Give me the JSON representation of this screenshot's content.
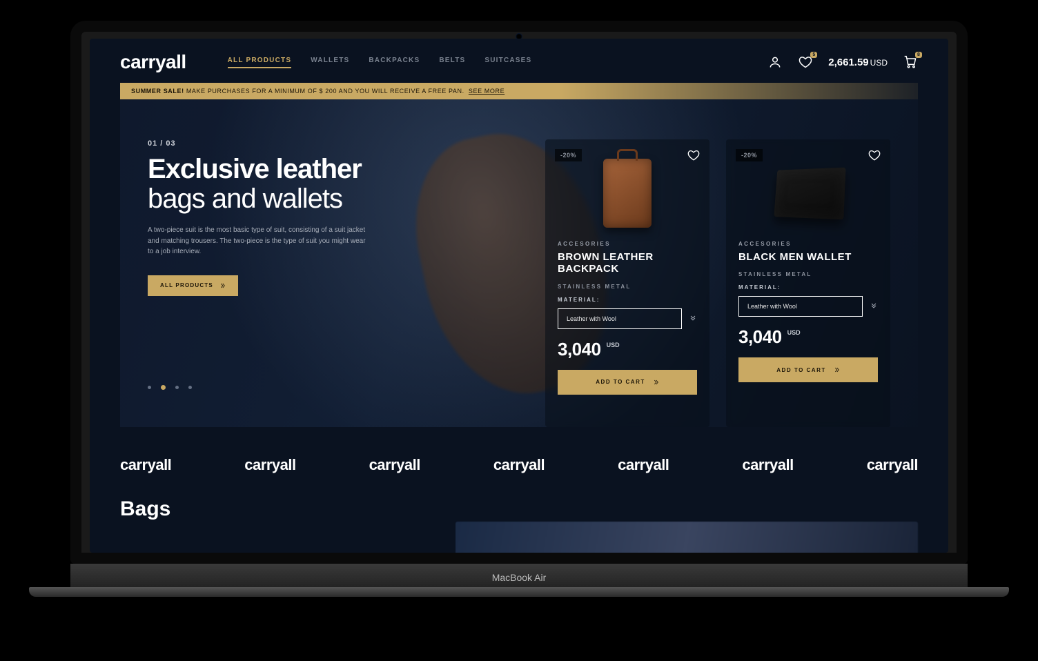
{
  "device_label": "MacBook Air",
  "brand": "carryall",
  "nav": {
    "items": [
      {
        "label": "ALL PRODUCTS",
        "active": true
      },
      {
        "label": "WALLETS",
        "active": false
      },
      {
        "label": "BACKPACKS",
        "active": false
      },
      {
        "label": "BELTS",
        "active": false
      },
      {
        "label": "SUITCASES",
        "active": false
      }
    ]
  },
  "header": {
    "wishlist_badge": "5",
    "cart_badge": "8",
    "balance": "2,661.59",
    "currency": "USD"
  },
  "promo": {
    "tag": "SUMMER SALE!",
    "text": "MAKE PURCHASES FOR A MINIMUM OF $ 200 AND YOU WILL RECEIVE A FREE PAN.",
    "see_more": "SEE MORE"
  },
  "hero": {
    "counter": "01 / 03",
    "title_bold": "Exclusive leather",
    "title_light": "bags and wallets",
    "description": "A two-piece suit is the most basic type of suit, consisting of a suit jacket and matching trousers. The two-piece is the type of suit you might wear to a job interview.",
    "cta": "ALL PRODUCTS",
    "active_dot": 1
  },
  "products": [
    {
      "discount": "-20%",
      "category": "ACCESORIES",
      "name": "BROWN LEATHER BACKPACK",
      "subtitle": "STAINLESS METAL",
      "material_label": "MATERIAL:",
      "material_value": "Leather with Wool",
      "price": "3,040",
      "currency": "USD",
      "button": "ADD TO CART"
    },
    {
      "discount": "-20%",
      "category": "ACCESORIES",
      "name": "BLACK MEN WALLET",
      "subtitle": "STAINLESS METAL",
      "material_label": "MATERIAL:",
      "material_value": "Leather with Wool",
      "price": "3,040",
      "currency": "USD",
      "button": "ADD TO CART"
    }
  ],
  "brand_strip": [
    "carryall",
    "carryall",
    "carryall",
    "carryall",
    "carryall",
    "carryall",
    "carryall"
  ],
  "section_title": "Bags"
}
